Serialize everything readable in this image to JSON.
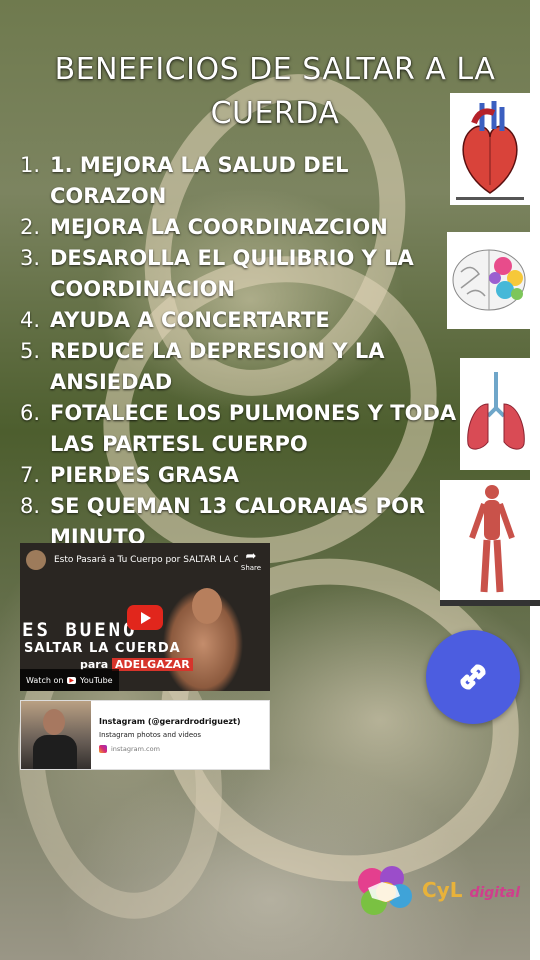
{
  "page": {
    "title": "BENEFICIOS DE SALTAR A LA CUERDA",
    "benefits": [
      {
        "num": "1.",
        "text": "1. MEJORA LA SALUD DEL CORAZON"
      },
      {
        "num": "2.",
        "text": "MEJORA LA COORDINAZCION"
      },
      {
        "num": "3.",
        "text": "DESAROLLA EL QUILIBRIO Y LA COORDINACION"
      },
      {
        "num": "4.",
        "text": "AYUDA A CONCERTARTE"
      },
      {
        "num": "5.",
        "text": "REDUCE LA DEPRESION Y LA ANSIEDAD"
      },
      {
        "num": "6.",
        "text": "FOTALECE LOS PULMONES Y TODA LAS PARTESL CUERPO"
      },
      {
        "num": "7.",
        "text": "PIERDES GRASA"
      },
      {
        "num": "8.",
        "text": "SE QUEMAN 13 CALORAIAS POR MINUTO"
      }
    ]
  },
  "side_images": [
    {
      "name": "heart-image",
      "caption": ""
    },
    {
      "name": "brain-image"
    },
    {
      "name": "lungs-image"
    },
    {
      "name": "muscles-image"
    }
  ],
  "video": {
    "title": "Esto Pasará a Tu Cuerpo por SALTAR LA C...",
    "share_label": "Share",
    "thumb_line1": "ES BUENO",
    "thumb_line2": "SALTAR LA CUERDA",
    "thumb_para": "para",
    "thumb_highlight": "ADELGAZAR",
    "watch_on": "Watch on",
    "youtube": "YouTube"
  },
  "instagram": {
    "title": "Instagram (@gerardrodriguezt)",
    "subtitle": "Instagram photos and videos",
    "url": "instagram.com"
  },
  "link_button": {
    "icon": "link-icon",
    "color": "#4c5de0"
  },
  "logo": {
    "text_cyl": "CyL",
    "text_digital": "digital"
  }
}
